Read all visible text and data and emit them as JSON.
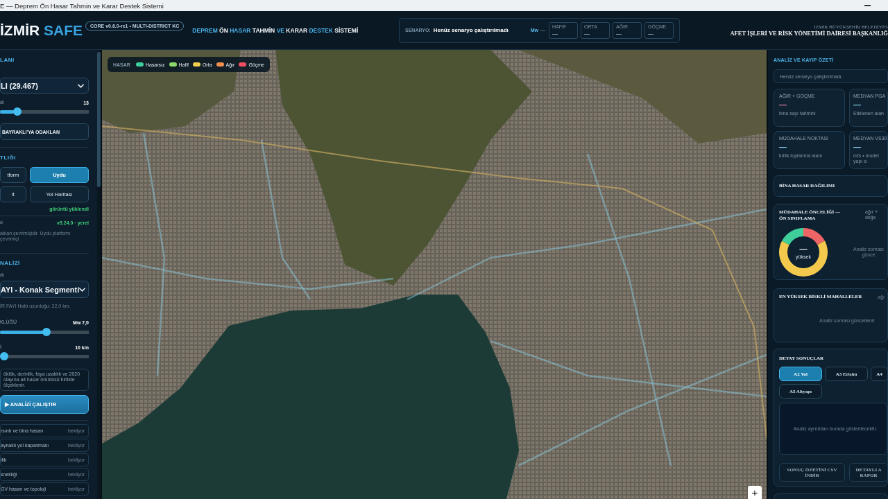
{
  "browser": {
    "title": "E — Deprem Ön Hasar Tahmin ve Karar Destek Sistemi"
  },
  "header": {
    "logo": {
      "main": "İZMİR",
      "accent": "SAFE"
    },
    "badge": "CORE v0.6.0-rc1 • MULTI-DISTRICT KC",
    "title_words": [
      {
        "text": "DEPREM",
        "accent": true
      },
      {
        "text": "ÖN",
        "accent": false
      },
      {
        "text": "HASAR",
        "accent": true
      },
      {
        "text": "TAHMİN",
        "accent": false
      },
      {
        "text": "VE",
        "accent": true
      },
      {
        "text": "KARAR",
        "accent": false
      },
      {
        "text": "DESTEK",
        "accent": true
      },
      {
        "text": "SİSTEMİ",
        "accent": false
      }
    ],
    "scenario": {
      "label": "SENARYO:",
      "value": "Henüz senaryo çalıştırılmadı",
      "magnitude_label": "Mw",
      "magnitude_value": "—",
      "stats": [
        {
          "label": "HAFİF",
          "value": "—"
        },
        {
          "label": "ORTA",
          "value": "—"
        },
        {
          "label": "AĞIR",
          "value": "—"
        },
        {
          "label": "GÖÇME",
          "value": "—"
        }
      ]
    },
    "organization": {
      "name": "İZMİR BÜYÜKŞEHİR BELEDİYES",
      "department": "AFET İŞLERİ VE RİSK YÖNETİMİ DAİRESİ BAŞKANLIĞ"
    }
  },
  "sidebar": {
    "district": {
      "title": "LANI",
      "select": "LI (29.467)",
      "zoom": {
        "label": "di",
        "value": "13",
        "level": 0.16
      },
      "focus_button": "BAYRAKLI'YA ODAKLAN"
    },
    "basemap": {
      "title": "TLIĞI",
      "options": [
        {
          "label": "tform",
          "selected": false
        },
        {
          "label": "Uydu",
          "selected": true
        },
        {
          "label": "it",
          "selected": false
        },
        {
          "label": "Yol Haritası",
          "selected": false
        }
      ],
      "status": "görüntü yüklendi",
      "version_label": "o",
      "version_value": "v5.24.0 · yerel",
      "note": "atılan çevrimiçidir. Uydu platform çevrimiçi"
    },
    "scenario": {
      "title": "NALİZİ",
      "fault_label": "dı",
      "fault_select": "AYI - Konak Segmenti",
      "fault_info": "İR FAYI Hattı uzunluğu: 22,0 km.",
      "magnitude": {
        "label": "KLÜĞÜ",
        "value": "Mw 7,0",
        "level": 0.53
      },
      "depth": {
        "label": "I",
        "value": "10 km",
        "level": 0
      },
      "info": "üklük, derinlik, faya uzaklık ve 2020 olayına ait hasar örüntüsü birlikte ölçeklenir.",
      "run_button": "▶ ANALİZİ ÇALIŞTIR",
      "modules": [
        {
          "name": "rsıntı ve bina hasarı",
          "status": "bekliyor"
        },
        {
          "name": "aynaklı yol kapanması",
          "status": "bekliyor"
        },
        {
          "name": "ilik",
          "status": "bekliyor"
        },
        {
          "name": "snekliği",
          "status": "bekliyor"
        },
        {
          "name": "GV hasarı ve topoloji",
          "status": "bekliyor"
        }
      ]
    }
  },
  "map": {
    "legend": {
      "title": "HASAR",
      "items": [
        {
          "label": "Hasarsız",
          "color": "#3ecf9e"
        },
        {
          "label": "Hafif",
          "color": "#8ed86a"
        },
        {
          "label": "Orta",
          "color": "#f2cc50"
        },
        {
          "label": "Ağır",
          "color": "#f0904e"
        },
        {
          "label": "Göçme",
          "color": "#ef4f5f"
        }
      ]
    },
    "zoom_in": "+"
  },
  "right_panel": {
    "title": "ANALİZ VE KAYIP ÖZETİ",
    "status": "Henüz senaryo çalıştırılmadı.",
    "metrics": [
      {
        "label": "AĞIR + GÖÇME",
        "value": "—",
        "note": "bina sayı tahmini",
        "color": "#e58ca0"
      },
      {
        "label": "MEDYAN PGA",
        "value": "—",
        "note": "Etkilenen alan",
        "color": "#8fd8f5"
      },
      {
        "label": "MÜDAHALE NOKTASI",
        "value": "—",
        "note": "kritik toplanma alanı",
        "color": "#8fd8f5"
      },
      {
        "label": "MEDYAN VS30",
        "value": "—",
        "note": "m/s • model yapı a",
        "color": "#8fd8f5"
      }
    ],
    "damage_distribution": {
      "title": "BİNA HASAR DAĞILIMI"
    },
    "priority": {
      "title": "MÜDAHALE ÖNCELİĞİ — ÖN SINIFLAMA",
      "side_note": "ağır + değe",
      "donut_value": "—",
      "donut_label": "yüksek",
      "placeholder": "Analiz sonrası günce"
    },
    "neighborhoods": {
      "title": "EN YÜKSEK RİSKLİ MAHALLELER",
      "side_note": "ağı",
      "placeholder": "Analiz sonrası güncellenir"
    },
    "details": {
      "title": "DETAY SONUÇLAR",
      "tabs": [
        {
          "label": "A2 Yol",
          "selected": true
        },
        {
          "label": "A3 Erişim",
          "selected": false
        },
        {
          "label": "A4",
          "selected": false
        },
        {
          "label": "A5 Altyapı",
          "selected": false
        }
      ],
      "placeholder": "Analiz ayrıntıları burada gösterilecektir.",
      "csv_button": "SONUÇ ÖZETİNİ CSV İNDİR",
      "report_button": "DETAYLI A RAPOR"
    }
  }
}
